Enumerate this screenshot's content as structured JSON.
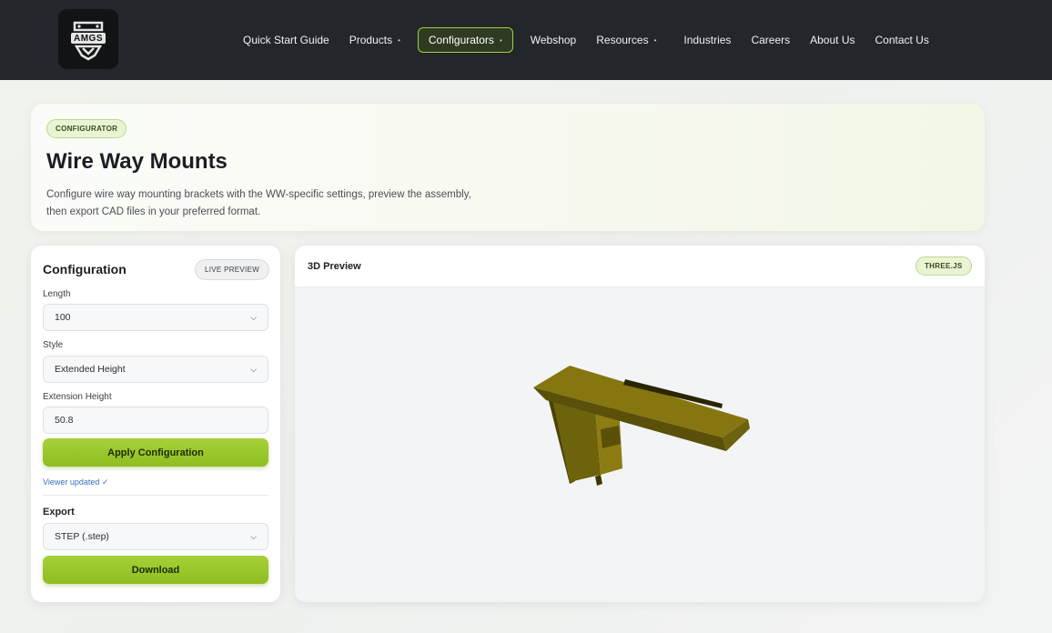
{
  "brand": {
    "logo_text": "AMGS"
  },
  "nav": {
    "items": [
      {
        "label": "Quick Start Guide",
        "caret": false
      },
      {
        "label": "Products",
        "caret": true
      },
      {
        "label": "Configurators",
        "caret": true,
        "active": true
      },
      {
        "label": "Webshop",
        "caret": false
      },
      {
        "label": "Resources",
        "caret": true
      },
      {
        "label": "Industries",
        "caret": false
      },
      {
        "label": "Careers",
        "caret": false
      },
      {
        "label": "About Us",
        "caret": false
      },
      {
        "label": "Contact Us",
        "caret": false
      }
    ],
    "caret_glyph": "•"
  },
  "hero": {
    "badge": "CONFIGURATOR",
    "title": "Wire Way Mounts",
    "description_line1": "Configure wire way mounting brackets with the WW-specific settings, preview the assembly,",
    "description_line2": "then export CAD files in your preferred format."
  },
  "config": {
    "title": "Configuration",
    "mode_badge": "LIVE PREVIEW",
    "length": {
      "label": "Length",
      "value": "100"
    },
    "style": {
      "label": "Style",
      "value": "Extended Height"
    },
    "extension_height": {
      "label": "Extension Height",
      "value": "50.8"
    },
    "apply_label": "Apply Configuration",
    "status": "Viewer updated ✓",
    "export": {
      "label": "Export",
      "format": "STEP (.step)"
    },
    "download_label": "Download"
  },
  "preview": {
    "title": "3D Preview",
    "engine_badge": "THREE.JS"
  },
  "colors": {
    "accent_green": "#9bd045",
    "model_color": "#8a7a10",
    "nav_bg": "#23262a"
  }
}
